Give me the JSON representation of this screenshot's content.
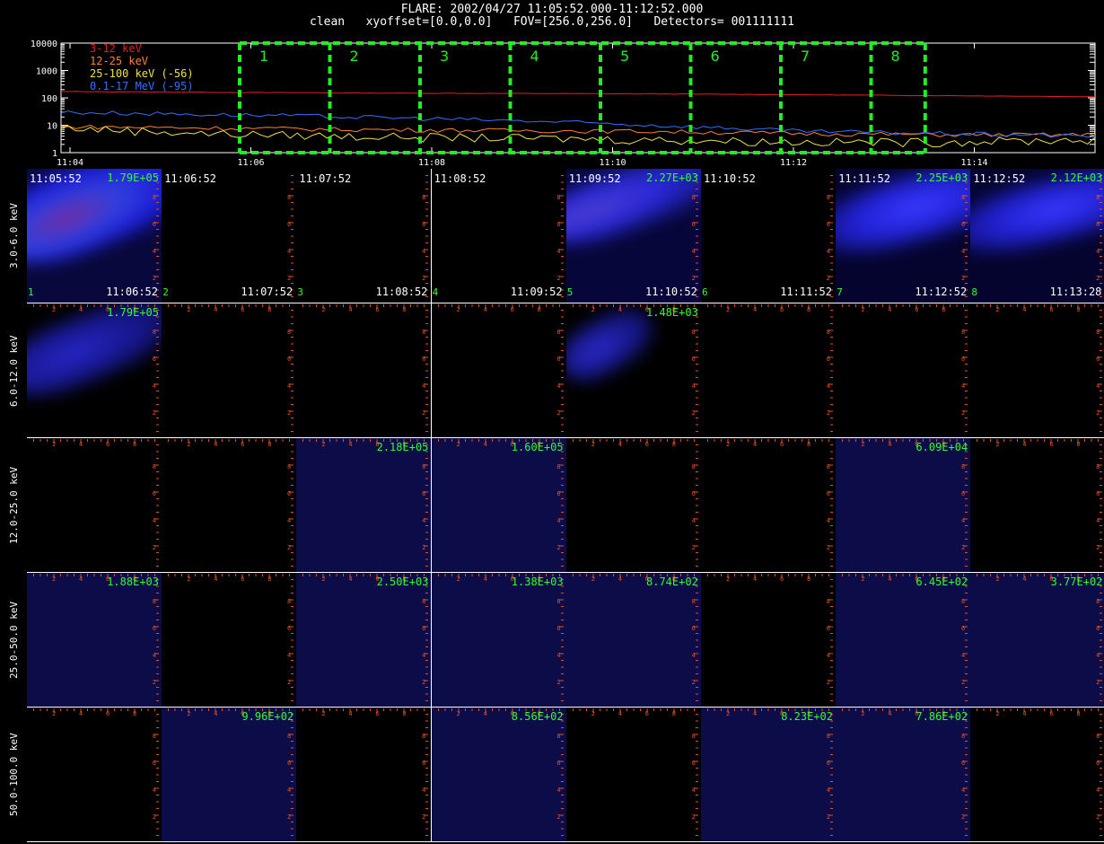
{
  "header": {
    "line1": "FLARE: 2002/04/27 11:05:52.000-11:12:52.000",
    "line2": "clean   xyoffset=[0.0,0.0]   FOV=[256.0,256.0]   Detectors= 001111111"
  },
  "chart_data": [
    {
      "type": "line",
      "ylog": true,
      "ylim": [
        1,
        10000
      ],
      "yticks": [
        "1",
        "10",
        "100",
        "1000",
        "10000"
      ],
      "xticks": [
        "11:04",
        "11:06",
        "11:08",
        "11:10",
        "11:12",
        "11:14"
      ],
      "legend_position": "top-left",
      "series": [
        {
          "name": "3-12 keV",
          "color": "#e02020",
          "values": [
            170,
            160,
            150,
            145,
            140,
            130,
            120,
            110
          ]
        },
        {
          "name": "12-25 keV",
          "color": "#ff8030",
          "values": [
            9,
            8,
            7,
            6.5,
            6,
            5,
            4.5,
            4.5
          ]
        },
        {
          "name": "25-100 keV (-56)",
          "color": "#f0e040",
          "values": [
            8,
            5,
            4,
            3.5,
            3,
            2.5,
            2.5,
            3
          ]
        },
        {
          "name": "0.1-17 MeV (-95)",
          "color": "#3070ff",
          "values": [
            30,
            25,
            20,
            15,
            10,
            6,
            5,
            4
          ]
        }
      ],
      "intervals": [
        "1",
        "2",
        "3",
        "4",
        "5",
        "6",
        "7",
        "8"
      ]
    },
    {
      "type": "heatmap",
      "energy_bands": [
        "3.0-6.0 keV",
        "6.0-12.0 keV",
        "12.0-25.0 keV",
        "25.0-50.0 keV",
        "50.0-100.0 keV"
      ],
      "start_times": [
        "11:05:52",
        "11:06:52",
        "11:07:52",
        "11:08:52",
        "11:09:52",
        "11:10:52",
        "11:11:52",
        "11:12:52"
      ],
      "end_times": [
        "11:06:52",
        "11:07:52",
        "11:08:52",
        "11:09:52",
        "11:10:52",
        "11:11:52",
        "11:12:52",
        "11:13:28"
      ],
      "interval_numbers": [
        "1",
        "2",
        "3",
        "4",
        "5",
        "6",
        "7",
        "8"
      ],
      "axis_ticks": [
        "2",
        "4",
        "6",
        "8"
      ],
      "peaks": [
        [
          "1.79E+05",
          "",
          "",
          "",
          "2.27E+03",
          "",
          "2.25E+03",
          "2.12E+03"
        ],
        [
          "1.79E+05",
          "",
          "",
          "",
          "1.48E+03",
          "",
          "",
          ""
        ],
        [
          "",
          "",
          "2.18E+05",
          "1.60E+05",
          "",
          "",
          "6.09E+04",
          ""
        ],
        [
          "1.88E+03",
          "",
          "2.50E+03",
          "1.38E+03",
          "8.74E+02",
          "",
          "6.45E+02",
          "3.77E+02"
        ],
        [
          "",
          "9.96E+02",
          "",
          "8.56E+02",
          "",
          "8.23E+02",
          "7.86E+02",
          ""
        ]
      ]
    }
  ]
}
